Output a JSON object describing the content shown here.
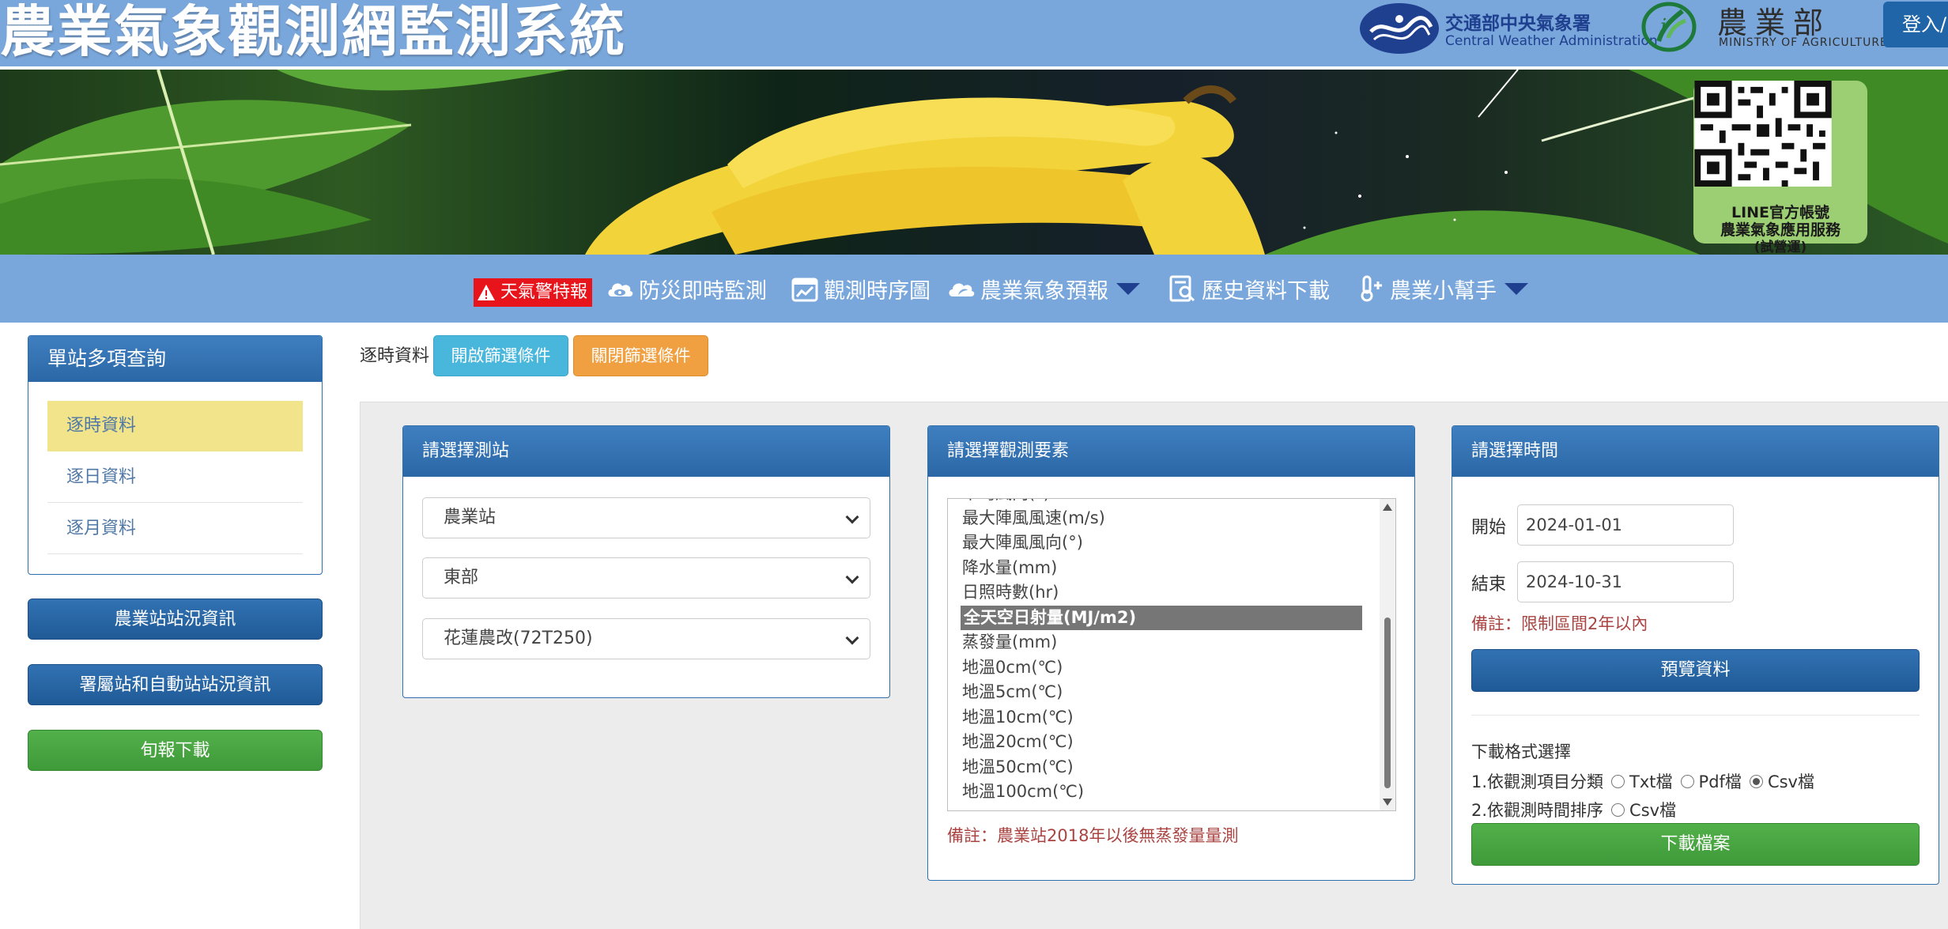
{
  "header": {
    "title": "農業氣象觀測網監測系統",
    "cwa_name": "交通部中央氣象署",
    "cwa_en": "Central Weather Administration",
    "moa_name": "農業部",
    "moa_en": "MINISTRY OF AGRICULTURE",
    "login_label": "登入/"
  },
  "banner": {
    "qr_lines": [
      "LINE官方帳號",
      "農業氣象應用服務",
      "(試營運)"
    ]
  },
  "nav": {
    "alert_label": "天氣警特報",
    "items": [
      {
        "label": "防災即時監測",
        "icon": "cloud-eye-icon"
      },
      {
        "label": "觀測時序圖",
        "icon": "calendar-chart-icon"
      },
      {
        "label": "農業氣象預報",
        "icon": "cloud-leaf-icon"
      },
      {
        "label": "歷史資料下載",
        "icon": "document-search-icon"
      },
      {
        "label": "農業小幫手",
        "icon": "thermometer-plus-icon"
      }
    ]
  },
  "sidebar": {
    "panel_title": "單站多項查詢",
    "links": [
      "逐時資料",
      "逐日資料",
      "逐月資料"
    ],
    "active_index": 0,
    "buttons": [
      "農業站站況資訊",
      "署屬站和自動站站況資訊",
      "旬報下載"
    ]
  },
  "filter": {
    "label": "逐時資料",
    "open_label": "開啟篩選條件",
    "close_label": "關閉篩選條件"
  },
  "station_panel": {
    "title": "請選擇測站",
    "selects": [
      "農業站",
      "東部",
      "花蓮農改(72T250)"
    ]
  },
  "element_panel": {
    "title": "請選擇觀測要素",
    "options": [
      "平均風向(°)",
      "最大陣風風速(m/s)",
      "最大陣風風向(°)",
      "降水量(mm)",
      "日照時數(hr)",
      "全天空日射量(MJ/m2)",
      "蒸發量(mm)",
      "地溫0cm(℃)",
      "地溫5cm(℃)",
      "地溫10cm(℃)",
      "地溫20cm(℃)",
      "地溫50cm(℃)",
      "地溫100cm(℃)"
    ],
    "selected": "全天空日射量(MJ/m2)",
    "note": "備註：農業站2018年以後無蒸發量量測"
  },
  "time_panel": {
    "title": "請選擇時間",
    "start_label": "開始",
    "start_value": "2024-01-01",
    "end_label": "結束",
    "end_value": "2024-10-31",
    "note": "備註：限制區間2年以內",
    "preview_label": "預覽資料",
    "format_title": "下載格式選擇",
    "format_row1_label": "1.依觀測項目分類",
    "format_row1_options": [
      "Txt檔",
      "Pdf檔",
      "Csv檔"
    ],
    "format_row1_selected": "Csv檔",
    "format_row2_label": "2.依觀測時間排序",
    "format_row2_options": [
      "Csv檔"
    ],
    "download_label": "下載檔案"
  },
  "colors": {
    "header_bg": "#7aa7db",
    "panel_head": "#2b67a6",
    "active_link": "#f1e48a",
    "alert": "#e8141c",
    "note": "#a94442",
    "green_btn": "#3f9a39",
    "open_btn": "#49b6dc",
    "close_btn": "#f0a040"
  }
}
